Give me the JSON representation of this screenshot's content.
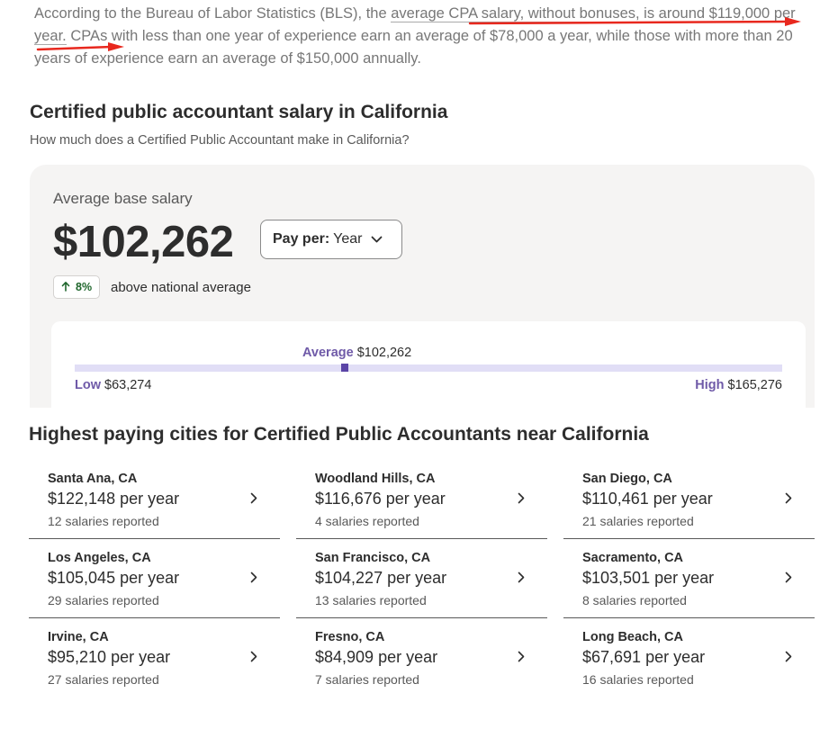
{
  "intro": {
    "part1": "According to the Bureau of Labor Statistics (BLS), the ",
    "part2": "average CPA salary, without bonuses, is around $119,000 per year.",
    "part3": " CPAs with less than one year of experience earn an average of $78,000 a year, while those with more than 20 years of experience earn an average of $150,000 annually."
  },
  "section": {
    "title": "Certified public accountant salary in California",
    "subtitle": "How much does a Certified Public Accountant make in California?"
  },
  "salary": {
    "average_label": "Average base salary",
    "amount": "$102,262",
    "pay_per_label": "Pay per:",
    "pay_per_value": "Year",
    "badge_percent": "8%",
    "badge_text": "above national average"
  },
  "range": {
    "average_label": "Average",
    "average_value": "$102,262",
    "low_label": "Low",
    "low_value": "$63,274",
    "high_label": "High",
    "high_value": "$165,276",
    "low_num": 63274,
    "high_num": 165276,
    "avg_num": 102262
  },
  "cities_title": "Highest paying cities for Certified Public Accountants near California",
  "cities": [
    {
      "name": "Santa Ana, CA",
      "pay": "$122,148 per year",
      "count": "12 salaries reported"
    },
    {
      "name": "Woodland Hills, CA",
      "pay": "$116,676 per year",
      "count": "4 salaries reported"
    },
    {
      "name": "San Diego, CA",
      "pay": "$110,461 per year",
      "count": "21 salaries reported"
    },
    {
      "name": "Los Angeles, CA",
      "pay": "$105,045 per year",
      "count": "29 salaries reported"
    },
    {
      "name": "San Francisco, CA",
      "pay": "$104,227 per year",
      "count": "13 salaries reported"
    },
    {
      "name": "Sacramento, CA",
      "pay": "$103,501 per year",
      "count": "8 salaries reported"
    },
    {
      "name": "Irvine, CA",
      "pay": "$95,210 per year",
      "count": "27 salaries reported"
    },
    {
      "name": "Fresno, CA",
      "pay": "$84,909 per year",
      "count": "7 salaries reported"
    },
    {
      "name": "Long Beach, CA",
      "pay": "$67,691 per year",
      "count": "16 salaries reported"
    }
  ],
  "colors": {
    "accent": "#6f5aa8",
    "marker": "#5b45a6",
    "bar": "#e1def6",
    "positive": "#1f662c",
    "annotation_arrow": "#e8281e"
  },
  "icons": {
    "pay_per_chevron": "chevron-down-icon",
    "badge": "arrow-up-icon",
    "city_link": "chevron-right-icon"
  }
}
